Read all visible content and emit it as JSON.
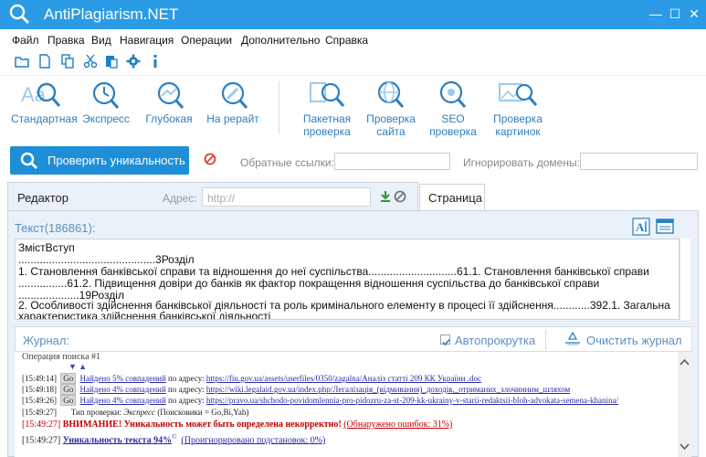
{
  "app": {
    "title": "AntiPlagiarism.NET",
    "accent": "#2b9be6"
  },
  "menu": [
    "Файл",
    "Правка",
    "Вид",
    "Навигация",
    "Операции",
    "Дополнительно",
    "Справка"
  ],
  "toolbar_icons": [
    "open-folder-icon",
    "new-file-icon",
    "copy-icon",
    "cut-icon",
    "paste-icon",
    "settings-icon",
    "info-icon"
  ],
  "ribbon": {
    "group1": [
      {
        "label": "Стандартная",
        "icon": "text-search-icon"
      },
      {
        "label": "Экспресс",
        "icon": "clock-search-icon"
      },
      {
        "label": "Глубокая",
        "icon": "deep-search-icon"
      },
      {
        "label": "На рерайт",
        "icon": "pencil-search-icon"
      }
    ],
    "group2": [
      {
        "label_l1": "Пакетная",
        "label_l2": "проверка",
        "icon": "batch-search-icon"
      },
      {
        "label_l1": "Проверка",
        "label_l2": "сайта",
        "icon": "globe-search-icon"
      },
      {
        "label_l1": "SEO",
        "label_l2": "проверка",
        "icon": "seo-search-icon"
      },
      {
        "label_l1": "Проверка",
        "label_l2": "картинок",
        "icon": "image-search-icon"
      }
    ]
  },
  "actions": {
    "check_button": "Проверить уникальность",
    "backlinks_label": "Обратные ссылки:",
    "backlinks_value": "",
    "ignore_domains_label": "Игнорировать домены:",
    "ignore_domains_value": ""
  },
  "tabs": {
    "editor": "Редактор",
    "address_label": "Адрес:",
    "address_placeholder": "http://",
    "page": "Страница"
  },
  "text": {
    "header": "Текст(186861):",
    "lines": [
      "ЗмістВступ",
      ".............................................3Розділ",
      "1. Становлення банківської справи та відношення до неї суспільства.............................61.1. Становлення банківської справи",
      "................61.2. Підвищення довіри до банків як фактор покращення відношення суспільства до банківської справи",
      "....................19Розділ",
      "2. Особливості здійснення банківської діяльності та роль кримінального елементу в процесі її здійснення............392.1. Загальна",
      "характеристика здійснення банківської діяльності"
    ]
  },
  "journal": {
    "label": "Журнал:",
    "autoscroll_label": "Автопрокрутка",
    "autoscroll_checked": true,
    "clear_label": "Очистить журнал",
    "operation": "Операция поиска #1",
    "arrows": "▼ ▲",
    "entries": [
      {
        "time": "[15:49:14]",
        "go": "Go",
        "found": "Найдено 5% совпадений",
        "by": "по адресу:",
        "url": "https://fiu.gov.ua/assets/userfiles/0350/zagalna/Аналіз статті 209 КК України .doc"
      },
      {
        "time": "[15:49:18]",
        "go": "Go",
        "found": "Найдено 4% совпадений",
        "by": "по адресу:",
        "url": "https://wiki.legalaid.gov.ua/index.php/Легалізація_(відмивання)_доходів,_отриманих_злочинним_шляхом"
      },
      {
        "time": "[15:49:26]",
        "go": "Go",
        "found": "Найдено 4% совпадений",
        "by": "по адресу:",
        "url": "https://pravo.ua/shchodo-povidomlennia-pro-pidozru-za-st-209-kk-ukrainy-v-starii-redaktsii-bloh-advokata-semena-khanina/"
      }
    ],
    "check_type_time": "[15:49:27]",
    "check_type_text": "Тип проверки:",
    "check_type_value": "Экспресс",
    "check_type_extra": "(Поисковики = Go,Bi,Yah)",
    "warning_time": "[15:49:27]",
    "warning_text": "ВНИМАНИЕ! Уникальность может быть определена некорректно!",
    "warning_detail": "(Обнаружено ошибок: 31%)",
    "result_time": "[15:49:27]",
    "result_text": "Уникальность текста 94%",
    "result_sup": "©",
    "result_detail": "(Проигнорировано подстановок: 0%)"
  }
}
